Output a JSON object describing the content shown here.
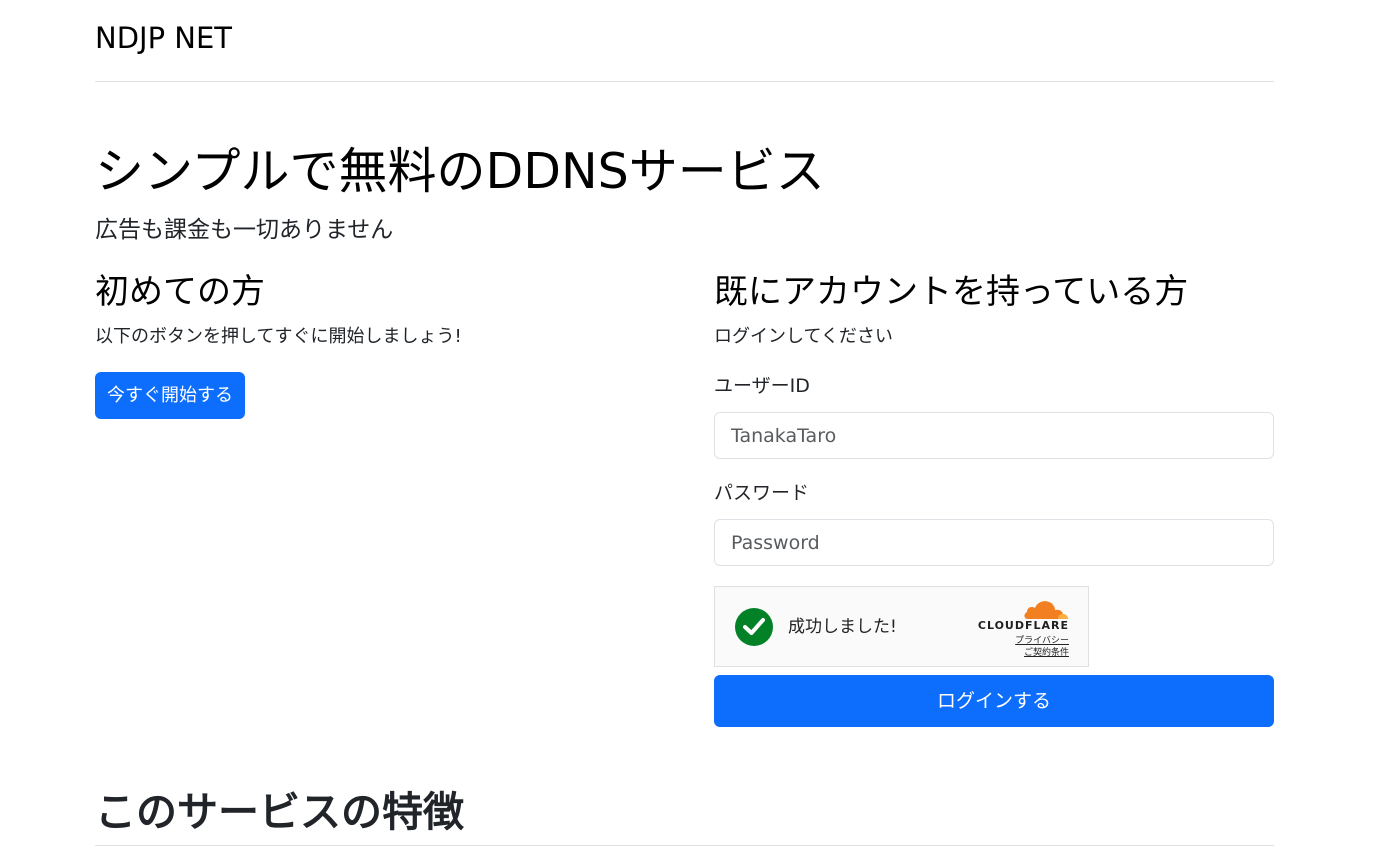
{
  "navbar": {
    "brand": "NDJP NET"
  },
  "hero": {
    "title": "シンプルで無料のDDNSサービス",
    "subtitle": "広告も課金も一切ありません"
  },
  "new_users": {
    "title": "初めての方",
    "text": "以下のボタンを押してすぐに開始しましょう!",
    "button_label": "今すぐ開始する"
  },
  "login": {
    "title": "既にアカウントを持っている方",
    "text": "ログインしてください",
    "user_id_label": "ユーザーID",
    "user_id_placeholder": "TanakaTaro",
    "password_label": "パスワード",
    "password_placeholder": "Password",
    "submit_label": "ログインする"
  },
  "captcha": {
    "status_text": "成功しました!",
    "brand": "CLOUDFLARE",
    "privacy_link": "プライバシー",
    "terms_link": "ご契約条件",
    "success_color": "#038127",
    "brand_color": "#f38020",
    "check_icon": "check-icon",
    "cloud_icon": "cloudflare-cloud-icon"
  },
  "features": {
    "title": "このサービスの特徴"
  },
  "colors": {
    "primary": "#0d6efd",
    "border": "#dee2e6"
  }
}
